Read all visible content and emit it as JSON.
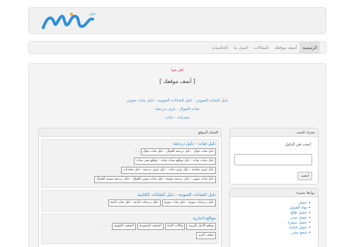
{
  "header": {
    "logo_text": "النغم",
    "logo_tag": "دليل"
  },
  "nav": {
    "items": [
      {
        "label": "الرئيسية"
      },
      {
        "label": "أضف موقعك"
      },
      {
        "label": "المقالات"
      },
      {
        "label": "اتصل بنا"
      },
      {
        "label": "الخلاصات"
      }
    ]
  },
  "main": {
    "red_link": "أهلن فيها",
    "title": "[ أضف موقعك ]",
    "links": [
      "دليل الشات الصوتي - دليل الشاتات الصوتيه - دليل شات صوتي",
      "شات الجوال - غرف دردشة",
      "منتديات - شات"
    ]
  },
  "sections": {
    "heading": "أقسام الموقع",
    "categories": [
      {
        "title": "دليل شات - دليل دردشة",
        "rows": [
          [
            "دليل شات جوال - دليل دردشة للجوال - دليل شات جوال",
            "- - -"
          ],
          [
            "دليل سناب شات - دليل مواقع سناب شات - مواقع نشر سناب"
          ],
          [
            "دليل غرف محادثة - دليل غرف شات - دليل غرف دردشة - دليل محادثات"
          ],
          [
            "دليل شات صوتي - دليل دردشة صوتية - دليل شات صوتي للجوال - دليل دردشة صوتيه للجوال"
          ]
        ]
      },
      {
        "title": "دليل الشاتات الصوتية - دليل الشاتات الكتابية",
        "rows": [
          [
            "دليل دردشات صوتية - دليل شات صوتية",
            "دليل دردشات كتابية - دليل شات كتابية"
          ]
        ]
      },
      {
        "title": "مواقع إخبارية",
        "rows": [
          [
            "مواقع الأخبار العربية",
            "وكالات الأنباء",
            "الصحف السعودية",
            "الصحف الكويتية",
            "- - - - -"
          ],
          [
            "صحف أخرى"
          ]
        ]
      }
    ]
  },
  "search": {
    "heading": "محرك البحث",
    "label": "ابحث في الدليل",
    "input_value": "",
    "button_label": "ابحث"
  },
  "links_panel": {
    "heading": "روابط مميزة",
    "items": [
      "عسل",
      "نقاء العسل",
      "عسل طلح",
      "عسل سدر",
      "عسل سمرة",
      "عسل قتادة",
      "شمع سدر"
    ]
  },
  "colors": {
    "link_blue": "#3a8fd0",
    "red": "#dd2233",
    "panel_bg": "#f4f4f4"
  }
}
